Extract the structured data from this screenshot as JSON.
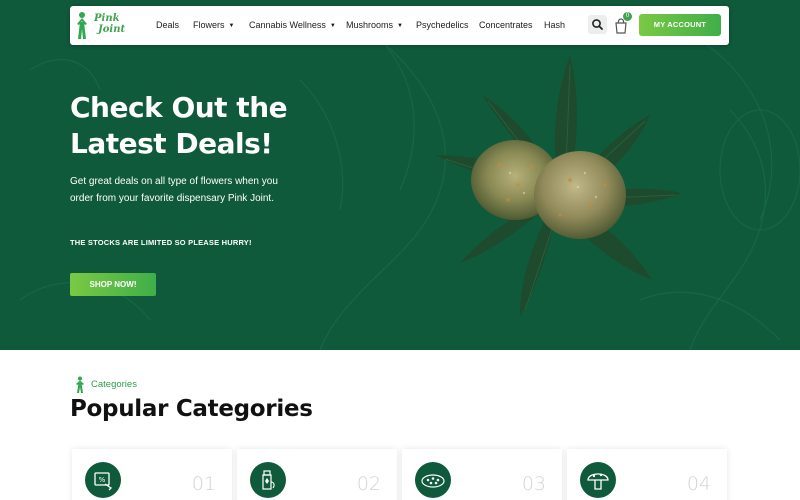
{
  "brand": {
    "logo_line1": "Pink",
    "logo_line2": "Joint"
  },
  "nav": {
    "items": [
      {
        "label": "Deals",
        "dropdown": false
      },
      {
        "label": "Flowers",
        "dropdown": true
      },
      {
        "label": "Cannabis Wellness",
        "dropdown": true
      },
      {
        "label": "Mushrooms",
        "dropdown": true
      },
      {
        "label": "Psychedelics",
        "dropdown": false
      },
      {
        "label": "Concentrates",
        "dropdown": false
      },
      {
        "label": "Hash",
        "dropdown": false
      }
    ],
    "search_icon": "search-icon",
    "cart_icon": "shopping-bag-icon",
    "cart_count": "0",
    "account_label": "MY ACCOUNT"
  },
  "hero": {
    "title": "Check Out the Latest Deals!",
    "description": "Get great deals on all type of flowers when you order from your favorite dispensary Pink Joint.",
    "note": "THE STOCKS ARE LIMITED SO PLEASE HURRY!",
    "cta_label": "SHOP NOW!",
    "image": "cannabis-bud-on-leaf"
  },
  "categories": {
    "eyebrow": "Categories",
    "title": "Popular Categories",
    "cards": [
      {
        "number": "01",
        "icon": "deals-icon"
      },
      {
        "number": "02",
        "icon": "bottle-icon"
      },
      {
        "number": "03",
        "icon": "flower-icon"
      },
      {
        "number": "04",
        "icon": "mushroom-icon"
      }
    ]
  },
  "colors": {
    "hero_bg": "#0f5a3a",
    "accent_green": "#3fae49",
    "accent_light": "#7ac943",
    "eyebrow_text": "#2e9e4a"
  }
}
